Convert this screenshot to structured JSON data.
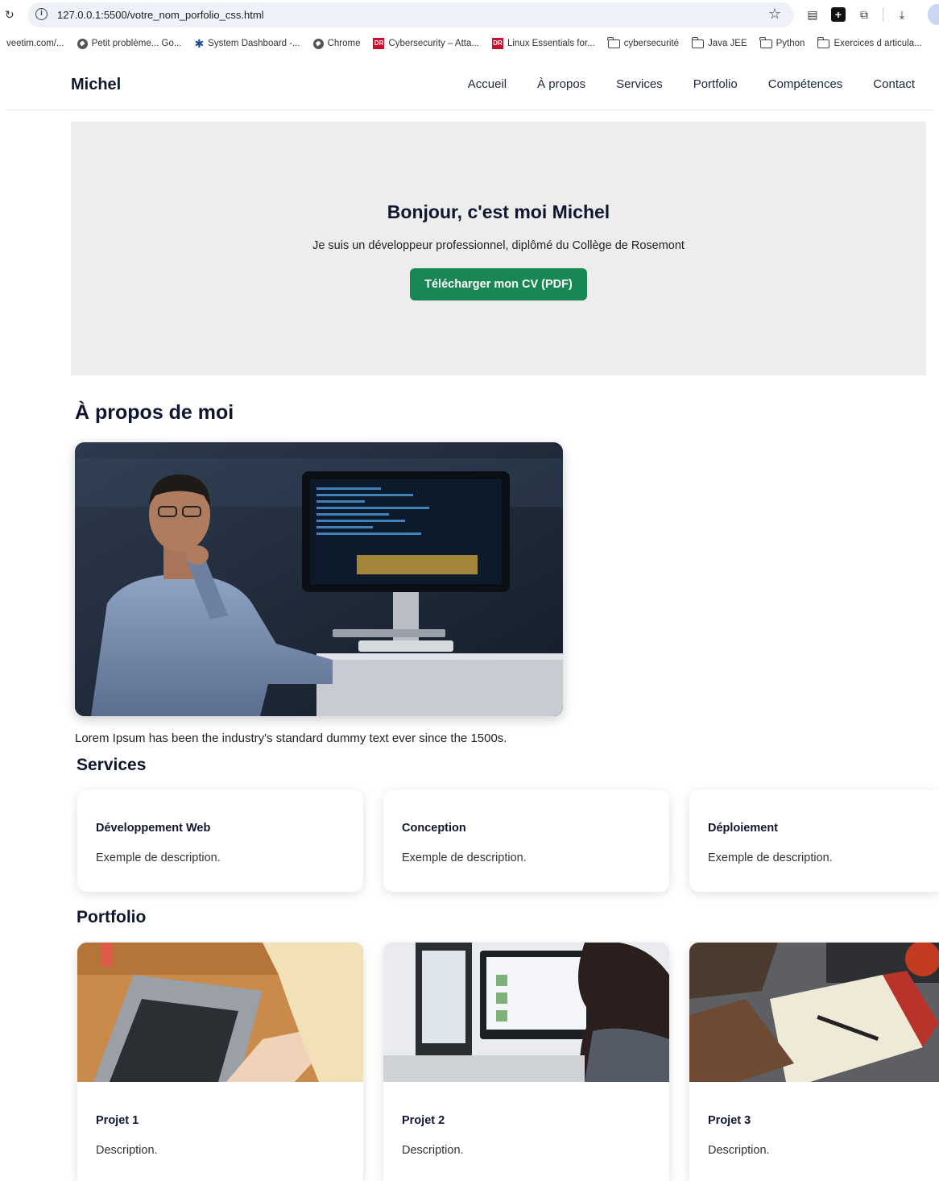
{
  "browser": {
    "url": "127.0.0.1:5500/votre_nom_porfolio_css.html",
    "bookmarks": [
      "veetim.com/...",
      "Petit problème... Go...",
      "System Dashboard -...",
      "Chrome",
      "Cybersecurity – Atta...",
      "Linux Essentials for...",
      "cybersecurité",
      "Java JEE",
      "Python",
      "Exercices d articula..."
    ]
  },
  "nav": {
    "brand": "Michel",
    "links": [
      "Accueil",
      "À propos",
      "Services",
      "Portfolio",
      "Compétences",
      "Contact"
    ]
  },
  "hero": {
    "title": "Bonjour, c'est moi Michel",
    "subtitle": "Je suis un développeur professionnel, diplômé du Collège de Rosemont",
    "button": "Télécharger mon CV (PDF)",
    "background": "#ededed",
    "button_color": "#198754"
  },
  "about": {
    "title": "À propos de moi",
    "text": "Lorem Ipsum has been the industry's standard dummy text ever since the 1500s."
  },
  "services": {
    "title": "Services",
    "items": [
      {
        "title": "Développement Web",
        "description": "Exemple de description."
      },
      {
        "title": "Conception",
        "description": "Exemple de description."
      },
      {
        "title": "Déploiement",
        "description": "Exemple de description."
      }
    ]
  },
  "portfolio": {
    "title": "Portfolio",
    "items": [
      {
        "title": "Projet 1",
        "description": "Description."
      },
      {
        "title": "Projet 2",
        "description": "Description."
      },
      {
        "title": "Projet 3",
        "description": "Description."
      }
    ]
  }
}
